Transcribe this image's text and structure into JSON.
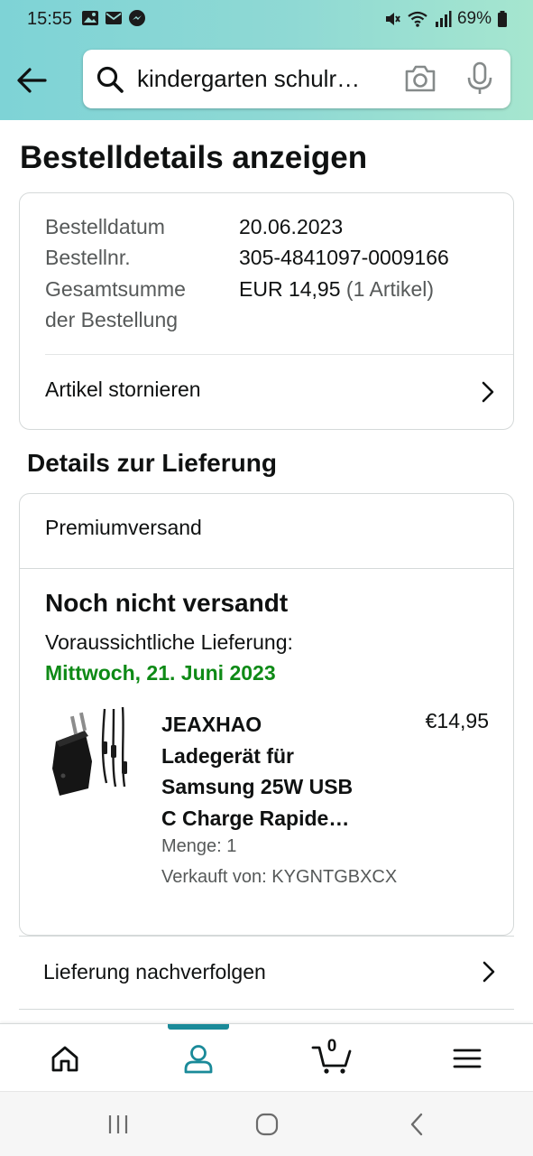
{
  "status_bar": {
    "time": "15:55",
    "battery": "69%",
    "left_icons": [
      "gallery-icon",
      "mail-icon",
      "messenger-icon"
    ],
    "right_icons": [
      "mute-icon",
      "wifi-icon",
      "signal-icon",
      "battery-icon"
    ]
  },
  "header": {
    "search_text": "kindergarten schulr…",
    "icons": [
      "back-arrow-icon",
      "search-icon",
      "camera-icon",
      "mic-icon"
    ]
  },
  "page": {
    "title": "Bestelldetails anzeigen"
  },
  "order_summary": {
    "date_label": "Bestelldatum",
    "date_value": "20.06.2023",
    "number_label": "Bestellnr.",
    "number_value": "305-4841097-0009166",
    "total_label_line1": "Gesamtsumme",
    "total_label_line2": "der Bestellung",
    "total_value": "EUR 14,95",
    "total_items": "(1 Artikel)",
    "cancel_link": "Artikel stornieren"
  },
  "delivery": {
    "section_title": "Details zur Lieferung",
    "shipping_method": "Premiumversand",
    "status": "Noch nicht versandt",
    "eta_label": "Voraussichtliche Lieferung:",
    "eta_date": "Mittwoch, 21. Juni 2023",
    "product": {
      "title_line1": "JEAXHAO",
      "title_line2": "Ladegerät für",
      "title_line3": "Samsung 25W USB",
      "title_line4": "C Charge Rapide…",
      "price": "€14,95",
      "quantity": "Menge: 1",
      "seller": "Verkauft von: KYGNTGBXCX"
    },
    "track_link": "Lieferung nachverfolgen"
  },
  "bottom_nav": {
    "items": [
      "home-icon",
      "account-icon",
      "cart-icon",
      "menu-icon"
    ],
    "active": "account-icon",
    "cart_count": "0"
  },
  "colors": {
    "header_gradient_start": "#7ed3d6",
    "header_gradient_end": "#a6e6cf",
    "eta_green": "#0e8a16",
    "active_nav": "#1a8a99",
    "muted_text": "#565959"
  }
}
